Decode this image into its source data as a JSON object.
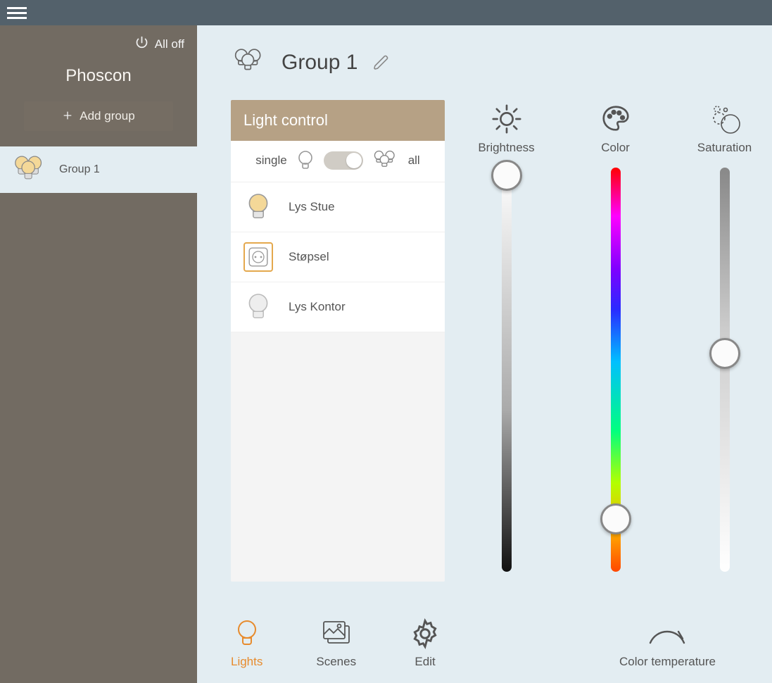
{
  "sidebar": {
    "all_off_label": "All off",
    "app_name": "Phoscon",
    "add_group_label": "Add group",
    "groups": [
      {
        "name": "Group 1"
      }
    ]
  },
  "header": {
    "group_title": "Group 1"
  },
  "light_panel": {
    "title": "Light control",
    "single_label": "single",
    "all_label": "all",
    "toggle_state": "all",
    "devices": [
      {
        "name": "Lys Stue",
        "type": "bulb",
        "on": true,
        "selected": false
      },
      {
        "name": "Støpsel",
        "type": "plug",
        "on": true,
        "selected": true
      },
      {
        "name": "Lys Kontor",
        "type": "bulb",
        "on": false,
        "selected": false
      }
    ]
  },
  "sliders": {
    "brightness": {
      "label": "Brightness",
      "position_pct": 2
    },
    "color": {
      "label": "Color",
      "position_pct": 87
    },
    "saturation": {
      "label": "Saturation",
      "position_pct": 46
    }
  },
  "tabs": {
    "lights": "Lights",
    "scenes": "Scenes",
    "edit": "Edit",
    "active": "lights"
  },
  "color_temp_label": "Color temperature"
}
